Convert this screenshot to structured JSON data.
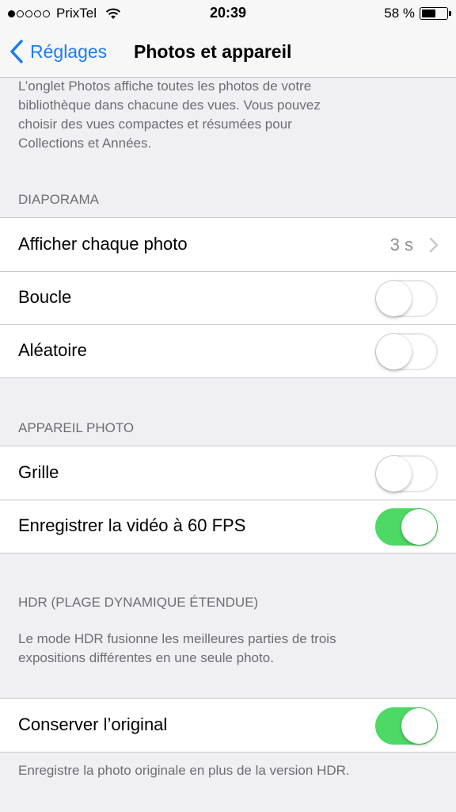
{
  "status_bar": {
    "carrier": "PrixTel",
    "time": "20:39",
    "battery_text": "58 %",
    "signal_bars": 1,
    "battery_level": 0.58
  },
  "nav": {
    "back_label": "Réglages",
    "title": "Photos et appareil"
  },
  "intro_footer": [
    "L’onglet Photos affiche toutes les photos de votre",
    "bibliothèque dans chacune des vues. Vous pouvez",
    "choisir des vues compactes et résumées pour",
    "Collections et Années."
  ],
  "diaporama": {
    "header": "DIAPORAMA",
    "rows": [
      {
        "label": "Afficher chaque photo",
        "value": "3 s"
      },
      {
        "label": "Boucle",
        "on": false
      },
      {
        "label": "Aléatoire",
        "on": false
      }
    ]
  },
  "appareil": {
    "header": "APPAREIL PHOTO",
    "rows": [
      {
        "label": "Grille",
        "on": false
      },
      {
        "label": "Enregistrer la vidéo à 60 FPS",
        "on": true
      }
    ]
  },
  "hdr": {
    "header": "HDR (PLAGE DYNAMIQUE ÉTENDUE)",
    "description": [
      "Le mode HDR fusionne les meilleures parties de trois",
      "expositions différentes en une seule photo."
    ],
    "rows": [
      {
        "label": "Conserver l’original",
        "on": true
      }
    ],
    "footer": "Enregistre la photo originale en plus de la version HDR."
  },
  "colors": {
    "accent": "#1a7cf5",
    "switch_on": "#4cd964",
    "secondary_text": "#6d6d72"
  },
  "icons": {
    "back": "chevron-left-icon",
    "disclosure": "chevron-right-icon",
    "wifi": "wifi-icon",
    "battery": "battery-icon"
  }
}
